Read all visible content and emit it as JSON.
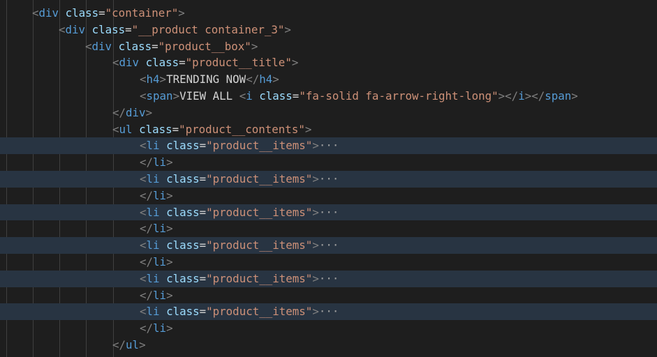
{
  "theme": {
    "background": "#1e1e1e",
    "highlight_row": "#283442",
    "tag_color": "#569cd6",
    "attr_color": "#9cdcfe",
    "string_color": "#ce9178",
    "text_color": "#d4d4d4",
    "punct_color": "#808080"
  },
  "top_fragment": "section",
  "bottom_fragment": "",
  "lines": [
    {
      "indent": 1,
      "hl": false,
      "tokens": [
        [
          "<",
          "punct"
        ],
        [
          "div",
          "tag"
        ],
        [
          " ",
          ""
        ],
        [
          "class",
          "attr"
        ],
        [
          "=",
          "eq"
        ],
        [
          "\"container\"",
          "str"
        ],
        [
          ">",
          "punct"
        ]
      ]
    },
    {
      "indent": 2,
      "hl": false,
      "tokens": [
        [
          "<",
          "punct"
        ],
        [
          "div",
          "tag"
        ],
        [
          " ",
          ""
        ],
        [
          "class",
          "attr"
        ],
        [
          "=",
          "eq"
        ],
        [
          "\"__product container_3\"",
          "str"
        ],
        [
          ">",
          "punct"
        ]
      ]
    },
    {
      "indent": 3,
      "hl": false,
      "tokens": [
        [
          "<",
          "punct"
        ],
        [
          "div",
          "tag"
        ],
        [
          " ",
          ""
        ],
        [
          "class",
          "attr"
        ],
        [
          "=",
          "eq"
        ],
        [
          "\"product__box\"",
          "str"
        ],
        [
          ">",
          "punct"
        ]
      ]
    },
    {
      "indent": 4,
      "hl": false,
      "tokens": [
        [
          "<",
          "punct"
        ],
        [
          "div",
          "tag"
        ],
        [
          " ",
          ""
        ],
        [
          "class",
          "attr"
        ],
        [
          "=",
          "eq"
        ],
        [
          "\"product__title\"",
          "str"
        ],
        [
          ">",
          "punct"
        ]
      ]
    },
    {
      "indent": 5,
      "hl": false,
      "tokens": [
        [
          "<",
          "punct"
        ],
        [
          "h4",
          "tag"
        ],
        [
          ">",
          "punct"
        ],
        [
          "TRENDING NOW",
          "text"
        ],
        [
          "</",
          "punct"
        ],
        [
          "h4",
          "tag"
        ],
        [
          ">",
          "punct"
        ]
      ]
    },
    {
      "indent": 5,
      "hl": false,
      "tokens": [
        [
          "<",
          "punct"
        ],
        [
          "span",
          "tag"
        ],
        [
          ">",
          "punct"
        ],
        [
          "VIEW ALL ",
          "text"
        ],
        [
          "<",
          "punct"
        ],
        [
          "i",
          "tag"
        ],
        [
          " ",
          ""
        ],
        [
          "class",
          "attr"
        ],
        [
          "=",
          "eq"
        ],
        [
          "\"fa-solid fa-arrow-right-long\"",
          "str"
        ],
        [
          "></",
          "punct"
        ],
        [
          "i",
          "tag"
        ],
        [
          "></",
          "punct"
        ],
        [
          "span",
          "tag"
        ],
        [
          ">",
          "punct"
        ]
      ]
    },
    {
      "indent": 4,
      "hl": false,
      "tokens": [
        [
          "</",
          "punct"
        ],
        [
          "div",
          "tag"
        ],
        [
          ">",
          "punct"
        ]
      ]
    },
    {
      "indent": 4,
      "hl": false,
      "tokens": [
        [
          "<",
          "punct"
        ],
        [
          "ul",
          "tag"
        ],
        [
          " ",
          ""
        ],
        [
          "class",
          "attr"
        ],
        [
          "=",
          "eq"
        ],
        [
          "\"product__contents\"",
          "str"
        ],
        [
          ">",
          "punct"
        ]
      ]
    },
    {
      "indent": 5,
      "hl": true,
      "fold": true,
      "tokens": [
        [
          "<",
          "punct"
        ],
        [
          "li",
          "tag"
        ],
        [
          " ",
          ""
        ],
        [
          "class",
          "attr"
        ],
        [
          "=",
          "eq"
        ],
        [
          "\"product__items\"",
          "str"
        ],
        [
          ">",
          "punct"
        ]
      ]
    },
    {
      "indent": 5,
      "hl": false,
      "tokens": [
        [
          "</",
          "punct"
        ],
        [
          "li",
          "tag"
        ],
        [
          ">",
          "punct"
        ]
      ]
    },
    {
      "indent": 5,
      "hl": true,
      "fold": true,
      "tokens": [
        [
          "<",
          "punct"
        ],
        [
          "li",
          "tag"
        ],
        [
          " ",
          ""
        ],
        [
          "class",
          "attr"
        ],
        [
          "=",
          "eq"
        ],
        [
          "\"product__items\"",
          "str"
        ],
        [
          ">",
          "punct"
        ]
      ]
    },
    {
      "indent": 5,
      "hl": false,
      "tokens": [
        [
          "</",
          "punct"
        ],
        [
          "li",
          "tag"
        ],
        [
          ">",
          "punct"
        ]
      ]
    },
    {
      "indent": 5,
      "hl": true,
      "fold": true,
      "tokens": [
        [
          "<",
          "punct"
        ],
        [
          "li",
          "tag"
        ],
        [
          " ",
          ""
        ],
        [
          "class",
          "attr"
        ],
        [
          "=",
          "eq"
        ],
        [
          "\"product__items\"",
          "str"
        ],
        [
          ">",
          "punct"
        ]
      ]
    },
    {
      "indent": 5,
      "hl": false,
      "tokens": [
        [
          "</",
          "punct"
        ],
        [
          "li",
          "tag"
        ],
        [
          ">",
          "punct"
        ]
      ]
    },
    {
      "indent": 5,
      "hl": true,
      "fold": true,
      "tokens": [
        [
          "<",
          "punct"
        ],
        [
          "li",
          "tag"
        ],
        [
          " ",
          ""
        ],
        [
          "class",
          "attr"
        ],
        [
          "=",
          "eq"
        ],
        [
          "\"product__items\"",
          "str"
        ],
        [
          ">",
          "punct"
        ]
      ]
    },
    {
      "indent": 5,
      "hl": false,
      "tokens": [
        [
          "</",
          "punct"
        ],
        [
          "li",
          "tag"
        ],
        [
          ">",
          "punct"
        ]
      ]
    },
    {
      "indent": 5,
      "hl": true,
      "fold": true,
      "tokens": [
        [
          "<",
          "punct"
        ],
        [
          "li",
          "tag"
        ],
        [
          " ",
          ""
        ],
        [
          "class",
          "attr"
        ],
        [
          "=",
          "eq"
        ],
        [
          "\"product__items\"",
          "str"
        ],
        [
          ">",
          "punct"
        ]
      ]
    },
    {
      "indent": 5,
      "hl": false,
      "tokens": [
        [
          "</",
          "punct"
        ],
        [
          "li",
          "tag"
        ],
        [
          ">",
          "punct"
        ]
      ]
    },
    {
      "indent": 5,
      "hl": true,
      "fold": true,
      "tokens": [
        [
          "<",
          "punct"
        ],
        [
          "li",
          "tag"
        ],
        [
          " ",
          ""
        ],
        [
          "class",
          "attr"
        ],
        [
          "=",
          "eq"
        ],
        [
          "\"product__items\"",
          "str"
        ],
        [
          ">",
          "punct"
        ]
      ]
    },
    {
      "indent": 5,
      "hl": false,
      "tokens": [
        [
          "</",
          "punct"
        ],
        [
          "li",
          "tag"
        ],
        [
          ">",
          "punct"
        ]
      ]
    },
    {
      "indent": 4,
      "hl": false,
      "tokens": [
        [
          "</",
          "punct"
        ],
        [
          "ul",
          "tag"
        ],
        [
          ">",
          "punct"
        ]
      ]
    }
  ],
  "fold_marker": "···"
}
